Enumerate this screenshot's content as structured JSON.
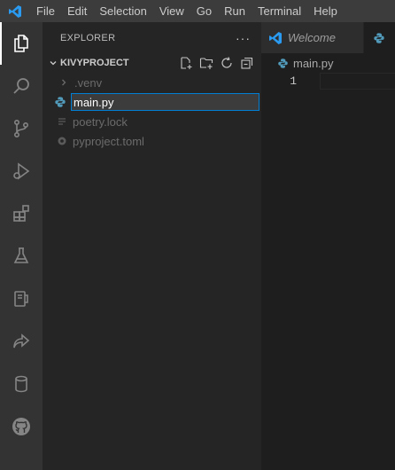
{
  "menu": {
    "items": [
      "File",
      "Edit",
      "Selection",
      "View",
      "Go",
      "Run",
      "Terminal",
      "Help"
    ]
  },
  "activity_bar": {
    "icons": [
      "explorer-icon",
      "search-icon",
      "source-control-icon",
      "run-debug-icon",
      "extensions-icon",
      "testing-icon",
      "remote-explorer-icon",
      "live-share-icon",
      "database-icon",
      "github-icon"
    ]
  },
  "sidebar": {
    "title": "EXPLORER",
    "more": "···",
    "section": "KIVYPROJECT",
    "tree": {
      "venv": ".venv",
      "rename_value": "main.py",
      "lock": "poetry.lock",
      "toml": "pyproject.toml"
    }
  },
  "editor": {
    "tabs": [
      {
        "label": "Welcome"
      },
      {
        "label": ""
      }
    ],
    "breadcrumb": "main.py",
    "line_number": "1"
  },
  "colors": {
    "accent": "#007fd4",
    "vscode_blue": "#2a9bf0",
    "python_blue": "#519aba"
  }
}
